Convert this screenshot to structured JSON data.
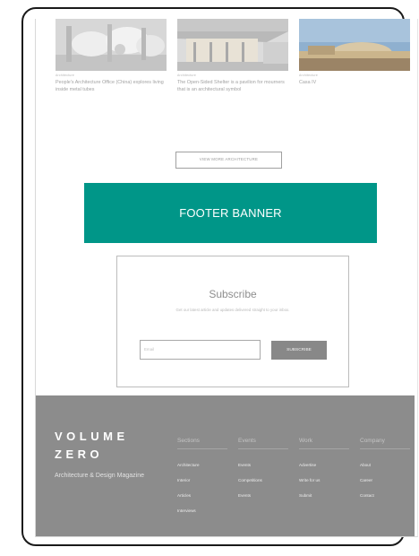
{
  "articles": [
    {
      "category": "Architecture",
      "title": "People's Architecture Office (China) explores living inside metal tubes"
    },
    {
      "category": "Architecture",
      "title": "The Open-Sided Shelter is a pavilion for mourners that is an architectural symbol"
    },
    {
      "category": "Architecture",
      "title": "Casa IV"
    }
  ],
  "view_more_label": "VIEW MORE ARCHITECTURE",
  "footer_banner_label": "FOOTER BANNER",
  "subscribe": {
    "title": "Subscribe",
    "text": "Get our latest article and updates delivered straight to your inbox.",
    "input_placeholder": "Email",
    "button_label": "SUBSCRIBE"
  },
  "footer": {
    "logo_line1": "VOLUME",
    "logo_line2": "ZERO",
    "tagline": "Architecture & Design Magazine",
    "columns": [
      {
        "heading": "Sections",
        "links": [
          "Architecture",
          "Interior",
          "Articles",
          "Interviews"
        ]
      },
      {
        "heading": "Events",
        "links": [
          "Events",
          "Competitions",
          "Events"
        ]
      },
      {
        "heading": "Work",
        "links": [
          "Advertise",
          "Write for us",
          "Submit"
        ]
      },
      {
        "heading": "Company",
        "links": [
          "About",
          "Career",
          "Contact"
        ]
      }
    ]
  }
}
